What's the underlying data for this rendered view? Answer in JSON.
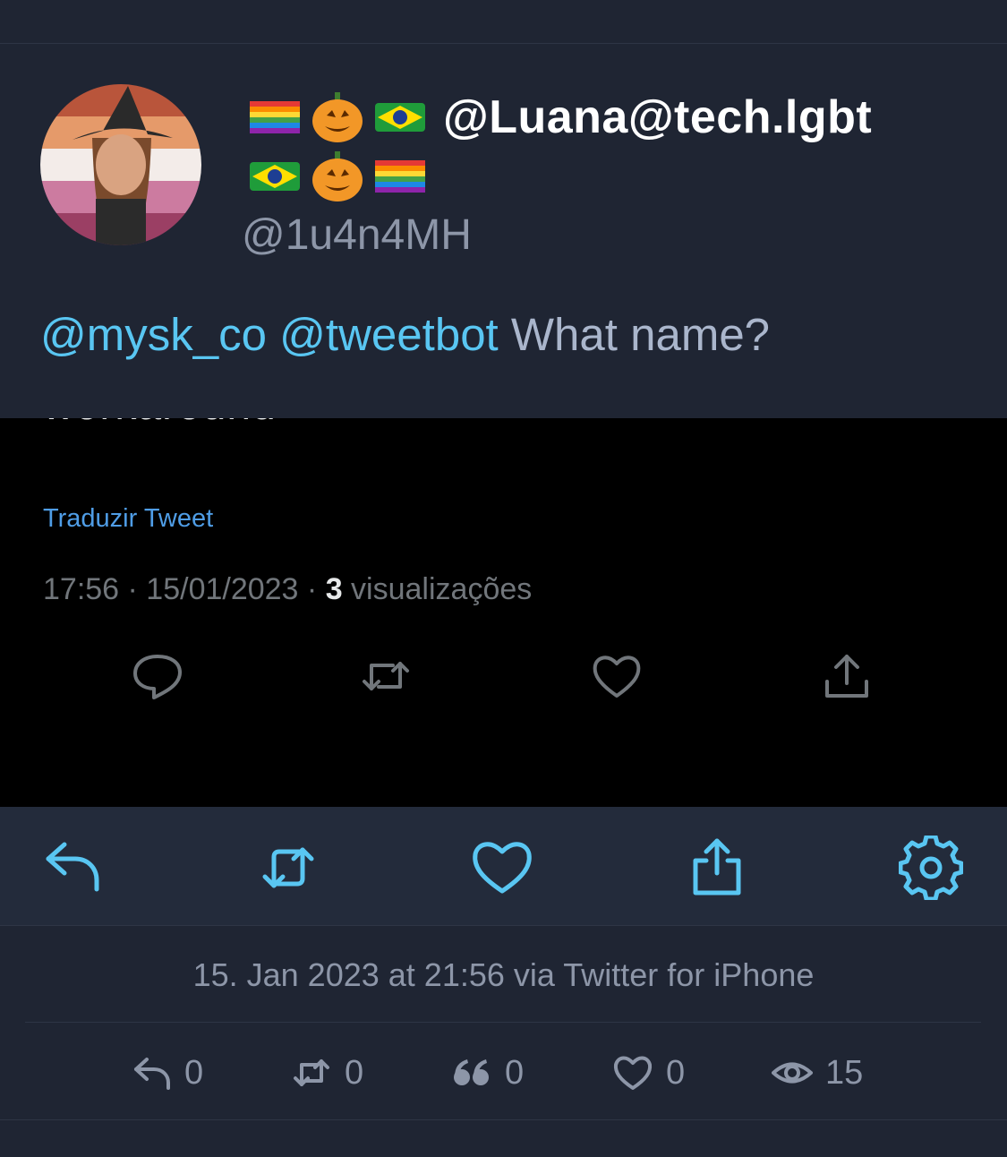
{
  "tweet": {
    "display_name": "@Luana@tech.lgbt",
    "handle": "@1u4n4MH",
    "mention1": "@mysk_co",
    "mention2": "@tweetbot",
    "text": "What name?"
  },
  "embedded": {
    "cut_text": "workaround",
    "translate": "Traduzir Tweet",
    "time_date": "17:56 · 15/01/2023 · ",
    "views_count": "3",
    "views_label": " visualizações"
  },
  "footer": {
    "dateline": "15. Jan 2023 at 21:56 via Twitter for iPhone",
    "replies": "0",
    "retweets": "0",
    "quotes": "0",
    "likes": "0",
    "views": "15"
  },
  "colors": {
    "accent": "#59c6f2",
    "background": "#1f2533",
    "muted": "#8d96a8"
  }
}
